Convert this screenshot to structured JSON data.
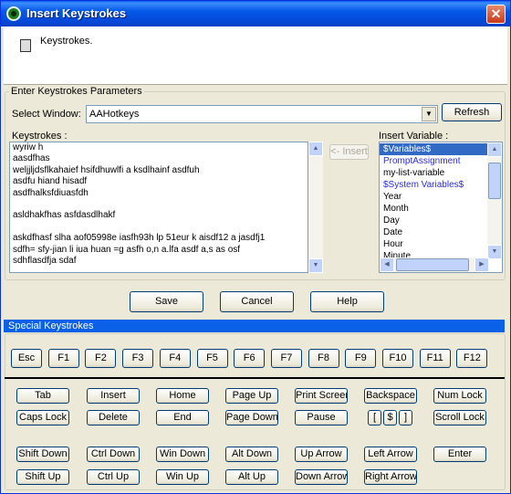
{
  "window": {
    "title": "Insert Keystrokes"
  },
  "header": {
    "description": "Keystrokes."
  },
  "params": {
    "legend": "Enter Keystrokes Parameters",
    "select_window_label": "Select Window:",
    "select_window_value": "AAHotkeys",
    "refresh_label": "Refresh",
    "keystrokes_label": "Keystrokes :",
    "insert_button_label": "<- Insert",
    "insert_variable_label": "Insert Variable :",
    "keystrokes_lines": [
      "wyriw h",
      "aasdfhas",
      "weljjljdsflkahaief hsifdhuwlfi a ksdlhainf asdfuh",
      "asdfu hiand hisadf",
      "asdfhalksfdiuasfdh",
      "",
      " asldhakfhas asfdasdlhakf",
      "",
      " askdfhasf slha aof05998e iasfh93h lp 51eur k aisdf12 a jasdfj1",
      "sdfh= sfy-jian li iua huan =g asfh o,n a.lfa asdf a,s as osf",
      "sdhflasdfja sdaf"
    ],
    "variables": [
      {
        "label": "$Variables$",
        "style": "selected"
      },
      {
        "label": "PromptAssignment",
        "style": "blue"
      },
      {
        "label": "my-list-variable",
        "style": "normal"
      },
      {
        "label": "$System Variables$",
        "style": "blue"
      },
      {
        "label": "Year",
        "style": "normal"
      },
      {
        "label": "Month",
        "style": "normal"
      },
      {
        "label": "Day",
        "style": "normal"
      },
      {
        "label": "Date",
        "style": "normal"
      },
      {
        "label": "Hour",
        "style": "normal"
      },
      {
        "label": "Minute",
        "style": "normal"
      }
    ]
  },
  "actions": {
    "save": "Save",
    "cancel": "Cancel",
    "help": "Help"
  },
  "special": {
    "title": "Special Keystrokes",
    "function_keys": [
      "Esc",
      "F1",
      "F2",
      "F3",
      "F4",
      "F5",
      "F6",
      "F7",
      "F8",
      "F9",
      "F10",
      "F11",
      "F12"
    ],
    "rows": [
      [
        "Tab",
        "Insert",
        "Home",
        "Page Up",
        "Print Screen",
        "Backspace",
        "Num Lock"
      ],
      [
        "Caps Lock",
        "Delete",
        "End",
        "Page Down",
        "Pause",
        "[",
        "$",
        "]",
        "Scroll Lock"
      ],
      [
        "Shift Down",
        "Ctrl Down",
        "Win Down",
        "Alt Down",
        "Up Arrow",
        "Left Arrow",
        "Enter"
      ],
      [
        "Shift Up",
        "Ctrl Up",
        "Win Up",
        "Alt Up",
        "Down Arrow",
        "Right Arrow"
      ]
    ]
  },
  "colors": {
    "title_bar": "#0458e8",
    "accent_bar": "#0a60e6",
    "face": "#ece9d8"
  }
}
